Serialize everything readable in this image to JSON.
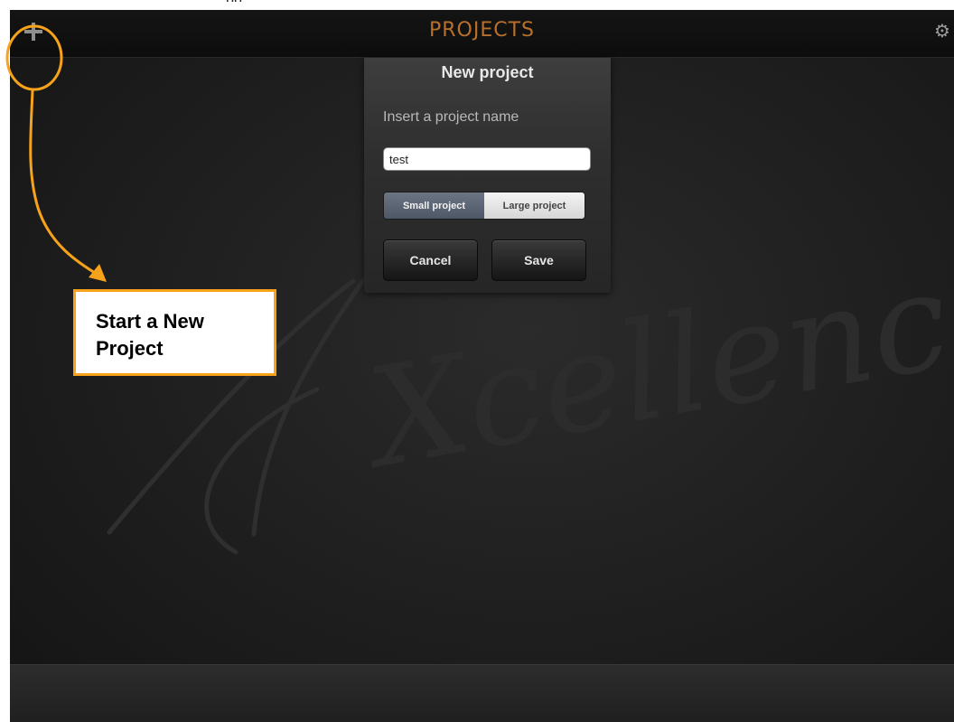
{
  "caption_fragment": "pp",
  "navbar": {
    "title": "PROJECTS",
    "add_icon": "plus-icon",
    "settings_icon": "gear-icon"
  },
  "watermark": {
    "text": "Xcellence"
  },
  "dialog": {
    "title": "New project",
    "prompt": "Insert a project name",
    "input_value": "test",
    "segments": {
      "small": "Small project",
      "large": "Large project",
      "selected": "Small project"
    },
    "cancel": "Cancel",
    "save": "Save"
  },
  "annotation": {
    "callout_line1": "Start a New",
    "callout_line2": "Project",
    "color": "#f7a21b"
  },
  "colors": {
    "title": "#b8702a",
    "selected_segment": "#5d6674"
  }
}
